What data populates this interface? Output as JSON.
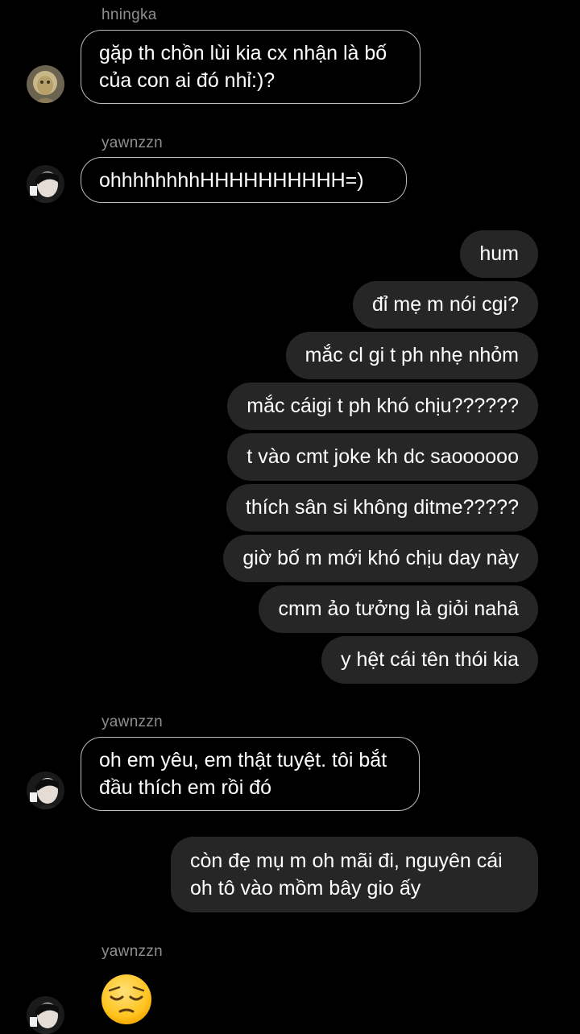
{
  "chat": {
    "messages": [
      {
        "sender": "hningka",
        "text": "gặp th chồn lùi kia cx nhận là bố\ncủa con ai đó nhỉ:)?"
      },
      {
        "sender": "yawnzzn",
        "text": "ohhhhhhhhHHHHHHHHHH=)"
      },
      {
        "outgoing": [
          "hum",
          "đỉ mẹ m nói cgi?",
          "mắc cl gi t ph nhẹ nhỏm",
          "mắc cáigi t ph khó chịu??????",
          "t vào cmt joke kh dc saoooooo",
          "thích sân si không ditme?????",
          "giờ bố m mới khó chịu day này",
          "cmm ảo tưởng là giỏi nahâ",
          "y hệt cái tên thói kia"
        ]
      },
      {
        "sender": "yawnzzn",
        "text": "oh em yêu, em thật tuyệt. tôi bắt\nđầu thích em rồi đó"
      },
      {
        "outgoing_long": "còn đẹ mụ m oh mãi đi, nguyên cái oh tô vào mồm bây gio ấy"
      },
      {
        "sender": "yawnzzn",
        "emoji": "pensive-face"
      }
    ]
  },
  "colors": {
    "background": "#000000",
    "incoming_border": "#bdbdbd",
    "outgoing_bubble": "#262626",
    "sender_name": "#8e8e8e"
  },
  "icons": {
    "avatar_hningka": "avatar-hningka",
    "avatar_yawnzzn": "avatar-yawnzzn",
    "emoji": "pensive-face-emoji"
  }
}
